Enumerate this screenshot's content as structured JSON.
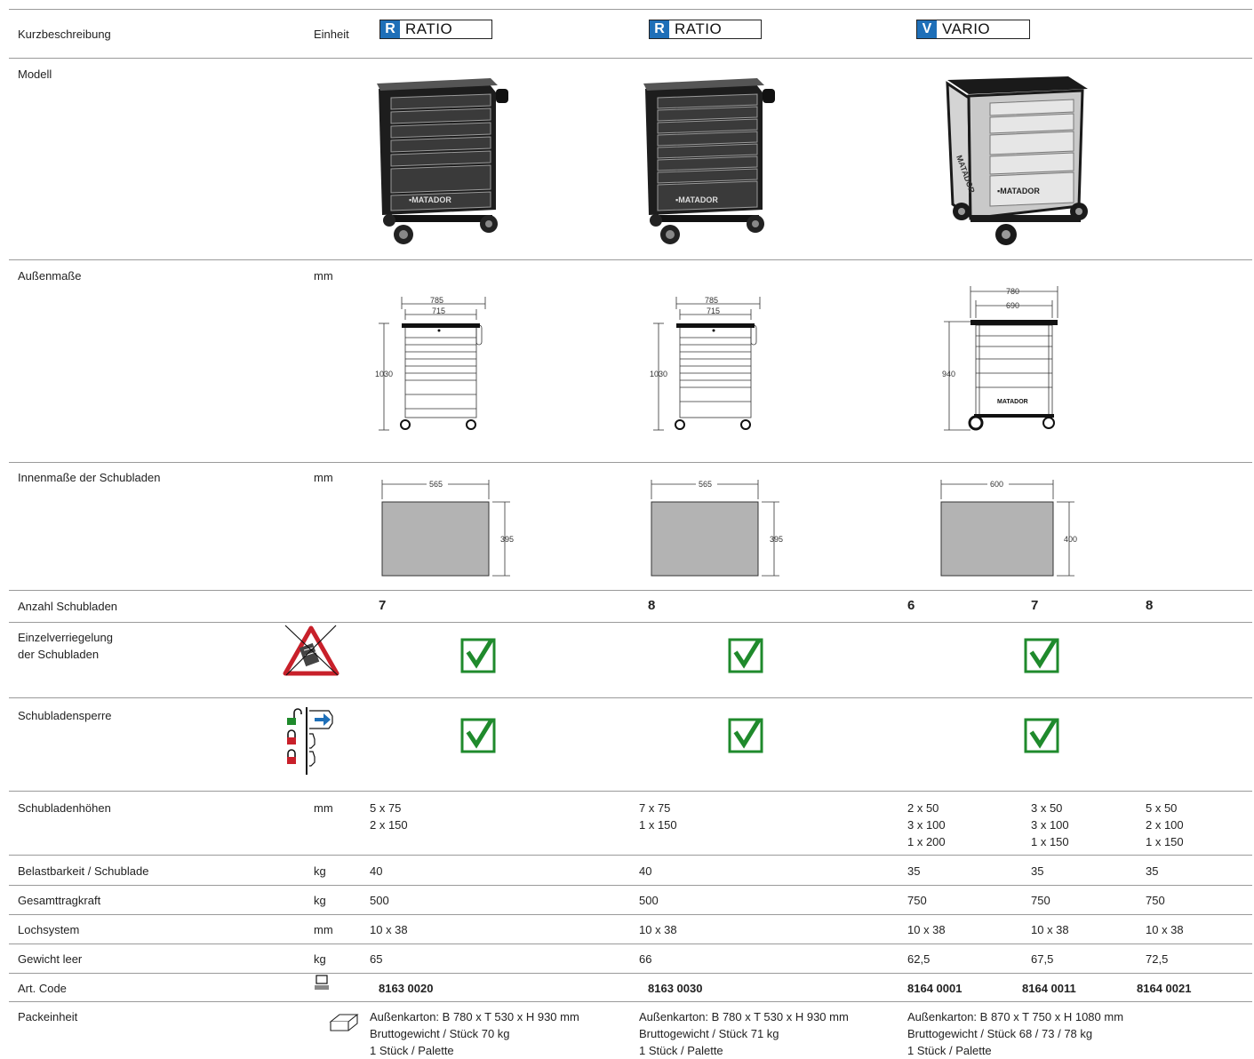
{
  "colors": {
    "accent_blue": "#1e6fb8",
    "check_green": "#1f8a2c",
    "drawer_grey": "#b3b3b3",
    "cabinet_dark": "#202020",
    "warning_red": "#c8202a"
  },
  "rows": {
    "kurzbeschreibung": "Kurzbeschreibung",
    "einheit": "Einheit",
    "modell": "Modell",
    "aussenmasse": "Außenmaße",
    "innenmasse": "Innenmaße der Schubladen",
    "anzahl": "Anzahl Schubladen",
    "einzelverriegelung_1": "Einzelverriegelung",
    "einzelverriegelung_2": "der Schubladen",
    "sperre": "Schubladensperre",
    "hoehen": "Schubladenhöhen",
    "belastbarkeit": "Belastbarkeit / Schublade",
    "gesamttragkraft": "Gesamttragkraft",
    "lochsystem": "Lochsystem",
    "gewicht": "Gewicht leer",
    "artcode": "Art. Code",
    "packeinheit": "Packeinheit"
  },
  "units": {
    "aussen": "mm",
    "innen": "mm",
    "hoehen": "mm",
    "belast": "kg",
    "gesamt": "kg",
    "loch": "mm",
    "gewicht": "kg"
  },
  "products": [
    {
      "badge_letter": "R",
      "badge_name": "RATIO",
      "outer_w": "785",
      "inner_w": "715",
      "height": "1030",
      "drawer_w": "565",
      "drawer_d": "395"
    },
    {
      "badge_letter": "R",
      "badge_name": "RATIO",
      "outer_w": "785",
      "inner_w": "715",
      "height": "1030",
      "drawer_w": "565",
      "drawer_d": "395"
    },
    {
      "badge_letter": "V",
      "badge_name": "VARIO",
      "outer_w": "780",
      "inner_w": "690",
      "height": "940",
      "drawer_w": "600",
      "drawer_d": "400"
    }
  ],
  "vario_brand": "MATADOR",
  "anzahl": [
    "7",
    "8",
    "6",
    "7",
    "8"
  ],
  "hoehen": [
    "5 x 75\n2 x 150",
    "7 x 75\n1 x 150",
    "2 x 50\n3 x 100\n1 x 200",
    "3 x 50\n3 x 100\n1 x 150",
    "5 x 50\n2 x 100\n1 x 150"
  ],
  "belastbarkeit": [
    "40",
    "40",
    "35",
    "35",
    "35"
  ],
  "gesamttragkraft": [
    "500",
    "500",
    "750",
    "750",
    "750"
  ],
  "lochsystem": [
    "10 x 38",
    "10 x 38",
    "10 x 38",
    "10 x 38",
    "10 x 38"
  ],
  "gewicht": [
    "65",
    "66",
    "62,5",
    "67,5",
    "72,5"
  ],
  "artcode": [
    "8163 0020",
    "8163 0030",
    "8164 0001",
    "8164 0011",
    "8164 0021"
  ],
  "pack": [
    "Außenkarton: B 780 x T 530 x H 930 mm\nBruttogewicht / Stück 70 kg\n1 Stück / Palette",
    "Außenkarton: B 780 x T 530 x H 930 mm\nBruttogewicht / Stück 71 kg\n1 Stück / Palette",
    "Außenkarton: B 870 x T 750 x H 1080 mm\nBruttogewicht / Stück 68 / 73 / 78 kg\n1 Stück / Palette"
  ]
}
